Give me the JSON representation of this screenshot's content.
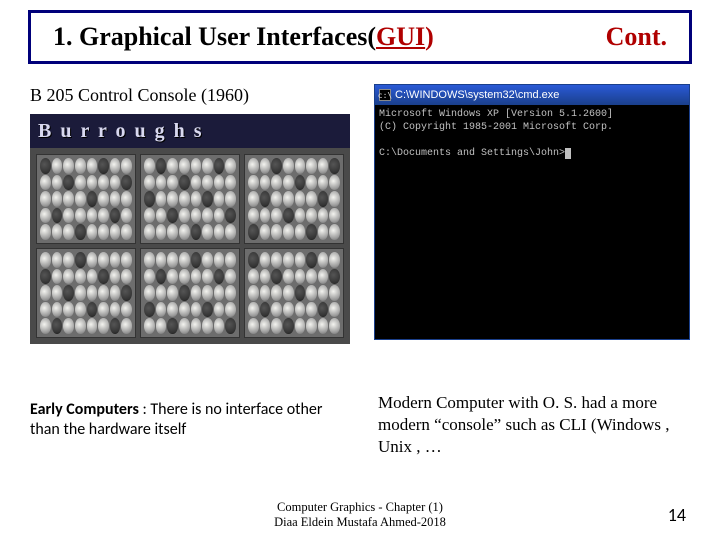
{
  "title": {
    "number": "1.",
    "main": "Graphical User Interfaces(",
    "gui": "GUI",
    "close": ")",
    "cont": "Cont."
  },
  "subtitle_left": "B 205  Control Console (1960)",
  "console_banner": "B u r r o u g h s",
  "cmd": {
    "titlebar_path": "C:\\WINDOWS\\system32\\cmd.exe",
    "line1": "Microsoft Windows XP [Version 5.1.2600]",
    "line2": "(C) Copyright 1985-2001 Microsoft Corp.",
    "line3": "C:\\Documents and Settings\\John>"
  },
  "caption_left": {
    "lead": "Early Computers",
    "rest": " : There is no interface other  than the hardware itself"
  },
  "caption_right": "Modern Computer with O. S. had  a more modern “console” such as CLI (Windows , Unix , …",
  "footer": {
    "line1": "Computer Graphics - Chapter (1)",
    "line2": "Diaa Eldein Mustafa Ahmed-2018"
  },
  "page_number": "14"
}
